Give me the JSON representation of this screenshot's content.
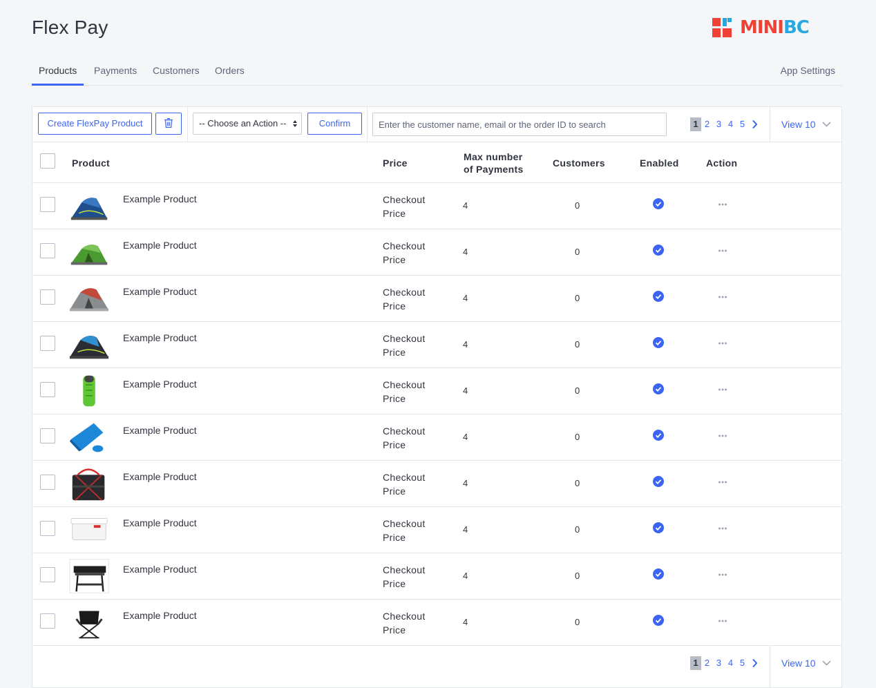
{
  "app": {
    "title": "Flex Pay"
  },
  "logo": {
    "text_mini": "MINI",
    "text_bc": "BC",
    "red": "#ef4136",
    "blue": "#29a8e0"
  },
  "tabs": [
    {
      "label": "Products",
      "active": true
    },
    {
      "label": "Payments",
      "active": false
    },
    {
      "label": "Customers",
      "active": false
    },
    {
      "label": "Orders",
      "active": false
    }
  ],
  "app_settings_label": "App Settings",
  "toolbar": {
    "create_label": "Create FlexPay Product",
    "action_select": "-- Choose an Action --",
    "confirm_label": "Confirm",
    "search_placeholder": "Enter the customer name, email or the order ID to search",
    "view_label": "View 10"
  },
  "pagination": {
    "pages": [
      "1",
      "2",
      "3",
      "4",
      "5"
    ],
    "current": "1"
  },
  "table": {
    "headers": {
      "product": "Product",
      "price": "Price",
      "max_payments_line1": "Max number",
      "max_payments_line2": "of Payments",
      "customers": "Customers",
      "enabled": "Enabled",
      "action": "Action"
    },
    "rows": [
      {
        "name": "Example Product",
        "price_line1": "Checkout",
        "price_line2": "Price",
        "max_payments": "4",
        "customers": "0",
        "enabled": true,
        "image": "tent-blue-icon"
      },
      {
        "name": "Example Product",
        "price_line1": "Checkout",
        "price_line2": "Price",
        "max_payments": "4",
        "customers": "0",
        "enabled": true,
        "image": "tent-green-icon"
      },
      {
        "name": "Example Product",
        "price_line1": "Checkout",
        "price_line2": "Price",
        "max_payments": "4",
        "customers": "0",
        "enabled": true,
        "image": "tent-grey-icon"
      },
      {
        "name": "Example Product",
        "price_line1": "Checkout",
        "price_line2": "Price",
        "max_payments": "4",
        "customers": "0",
        "enabled": true,
        "image": "tent-dark-icon"
      },
      {
        "name": "Example Product",
        "price_line1": "Checkout",
        "price_line2": "Price",
        "max_payments": "4",
        "customers": "0",
        "enabled": true,
        "image": "sleeping-bag-green-icon"
      },
      {
        "name": "Example Product",
        "price_line1": "Checkout",
        "price_line2": "Price",
        "max_payments": "4",
        "customers": "0",
        "enabled": true,
        "image": "sleeping-bag-blue-icon"
      },
      {
        "name": "Example Product",
        "price_line1": "Checkout",
        "price_line2": "Price",
        "max_payments": "4",
        "customers": "0",
        "enabled": true,
        "image": "duffel-bag-icon"
      },
      {
        "name": "Example Product",
        "price_line1": "Checkout",
        "price_line2": "Price",
        "max_payments": "4",
        "customers": "0",
        "enabled": true,
        "image": "cooler-icon"
      },
      {
        "name": "Example Product",
        "price_line1": "Checkout",
        "price_line2": "Price",
        "max_payments": "4",
        "customers": "0",
        "enabled": true,
        "image": "griddle-grill-icon"
      },
      {
        "name": "Example Product",
        "price_line1": "Checkout",
        "price_line2": "Price",
        "max_payments": "4",
        "customers": "0",
        "enabled": true,
        "image": "camp-chair-icon"
      }
    ]
  },
  "colors": {
    "accent": "#3c64f4",
    "text": "#313440",
    "muted": "#5e637a",
    "border": "#e2e5e9"
  }
}
